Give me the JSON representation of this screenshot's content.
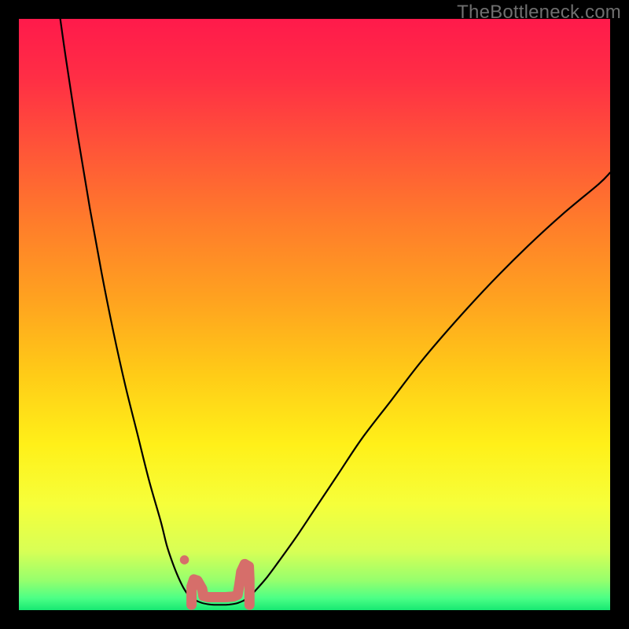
{
  "watermark": "TheBottleneck.com",
  "gradient_stops": [
    {
      "offset": 0.0,
      "color": "#ff1a4b"
    },
    {
      "offset": 0.1,
      "color": "#ff2e45"
    },
    {
      "offset": 0.22,
      "color": "#ff5538"
    },
    {
      "offset": 0.35,
      "color": "#ff7e2a"
    },
    {
      "offset": 0.48,
      "color": "#ffa41f"
    },
    {
      "offset": 0.6,
      "color": "#ffcb17"
    },
    {
      "offset": 0.72,
      "color": "#fff019"
    },
    {
      "offset": 0.82,
      "color": "#f6ff3a"
    },
    {
      "offset": 0.9,
      "color": "#d8ff55"
    },
    {
      "offset": 0.95,
      "color": "#96ff6d"
    },
    {
      "offset": 0.98,
      "color": "#4bff86"
    },
    {
      "offset": 1.0,
      "color": "#17e872"
    }
  ],
  "chart_data": {
    "type": "line",
    "title": "",
    "xlabel": "",
    "ylabel": "",
    "xlim": [
      0,
      100
    ],
    "ylim": [
      0,
      100
    ],
    "grid": false,
    "legend": false,
    "series": [
      {
        "name": "left-branch",
        "x": [
          7,
          8,
          10,
          12,
          14,
          16,
          18,
          20,
          22,
          24,
          25,
          26,
          27,
          28,
          29,
          30
        ],
        "y": [
          100,
          93,
          80,
          68,
          57,
          47,
          38,
          30,
          22,
          15,
          11,
          8,
          5.5,
          3.5,
          2.2,
          1.6
        ]
      },
      {
        "name": "right-branch",
        "x": [
          38,
          39,
          40,
          42,
          44,
          47,
          50,
          54,
          58,
          63,
          68,
          74,
          80,
          86,
          92,
          98,
          100
        ],
        "y": [
          1.6,
          2.3,
          3.3,
          5.6,
          8.3,
          12.5,
          17,
          23,
          29,
          35.5,
          42,
          49,
          55.5,
          61.5,
          67,
          72,
          74
        ]
      },
      {
        "name": "flat-basin",
        "x": [
          30,
          31,
          32,
          33,
          34,
          35,
          36,
          37,
          38
        ],
        "y": [
          1.6,
          1.2,
          1.0,
          0.9,
          0.9,
          0.9,
          1.0,
          1.2,
          1.6
        ]
      }
    ],
    "markers": [
      {
        "name": "pink-dot",
        "x": 28.0,
        "y": 8.5,
        "r": 1.0,
        "color": "#d66e6a"
      },
      {
        "name": "basin-chunk",
        "type": "pink-blob",
        "color": "#d66e6a",
        "path_xy": [
          [
            29.2,
            0.9
          ],
          [
            29.2,
            4.0
          ],
          [
            29.6,
            5.2
          ],
          [
            30.2,
            5.0
          ],
          [
            31.0,
            3.6
          ],
          [
            31.2,
            2.4
          ],
          [
            32.0,
            2.2
          ],
          [
            33.5,
            2.2
          ],
          [
            35.0,
            2.2
          ],
          [
            36.3,
            2.3
          ],
          [
            37.0,
            2.6
          ],
          [
            37.3,
            4.4
          ],
          [
            37.6,
            6.5
          ],
          [
            38.2,
            7.8
          ],
          [
            38.9,
            7.4
          ],
          [
            39.0,
            5.2
          ],
          [
            39.0,
            0.9
          ]
        ]
      }
    ]
  }
}
